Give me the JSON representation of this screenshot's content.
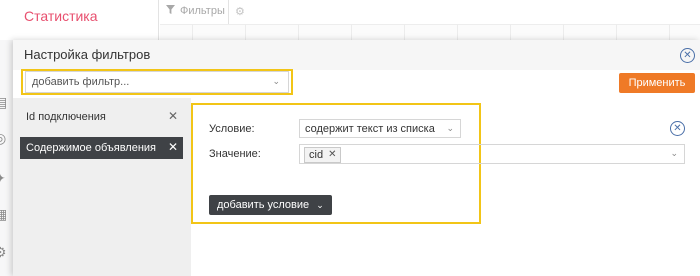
{
  "background": {
    "section_title": "Статистика",
    "filters_label": "Фильтры",
    "filter_icon": "filter-icon",
    "settings_icon": "gear-icon"
  },
  "panel": {
    "title": "Настройка фильтров",
    "close_icon": "close-circle-icon",
    "add_filter": {
      "value": "добавить фильтр...",
      "icon": "chevron-down-icon"
    },
    "apply_label": "Применить",
    "filters": [
      {
        "label": "Id подключения",
        "selected": false
      },
      {
        "label": "Содержимое объявления",
        "selected": true
      }
    ]
  },
  "editor": {
    "condition_label": "Условие:",
    "condition_value": "содержит текст из списка",
    "value_label": "Значение:",
    "value_tags": [
      "cid"
    ],
    "add_condition_label": "добавить условие"
  },
  "colors": {
    "accent": "#ef7a27",
    "highlight": "#f2c517",
    "title_pink": "#e8506f",
    "dark": "#3f4246",
    "link_blue": "#4a6fa8"
  }
}
